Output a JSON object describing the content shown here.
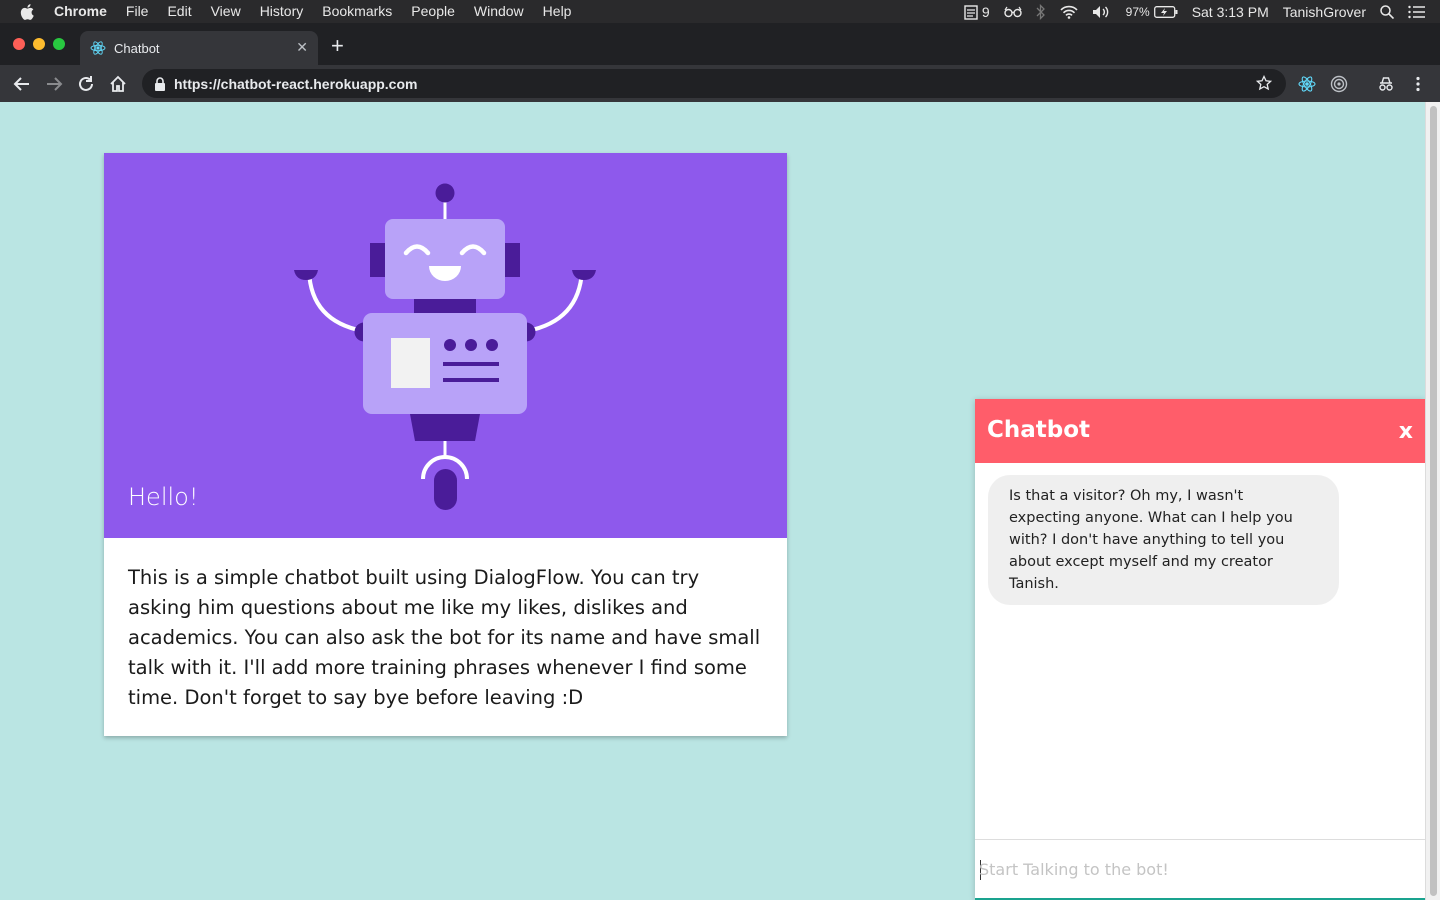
{
  "menubar": {
    "app": "Chrome",
    "items": [
      "File",
      "Edit",
      "View",
      "History",
      "Bookmarks",
      "People",
      "Window",
      "Help"
    ],
    "notes_count": "9",
    "battery": "97%",
    "clock": "Sat 3:13 PM",
    "user": "TanishGrover"
  },
  "tab": {
    "title": "Chatbot"
  },
  "omnibox": {
    "proto": "https://",
    "host": "chatbot-react.herokuapp.com"
  },
  "card": {
    "hero_title": "Hello!",
    "body": "This is a simple chatbot built using DialogFlow. You can try asking him questions about me like my likes, dislikes and academics. You can also ask the bot for its name and have small talk with it. I'll add more training phrases whenever I find some time. Don't forget to say bye before leaving :D"
  },
  "chat": {
    "title": "Chatbot",
    "close_label": "x",
    "messages": [
      {
        "from": "bot",
        "text": "Is that a visitor? Oh my, I wasn't expecting anyone. What can I help you with? I don't have anything to tell you about except myself and my creator Tanish."
      }
    ],
    "input_placeholder": "Start Talking to the bot!"
  },
  "colors": {
    "page_bg": "#bae5e3",
    "hero_bg": "#8e59ec",
    "chat_header": "#ff5d6a",
    "bubble_bg": "#efefef"
  }
}
